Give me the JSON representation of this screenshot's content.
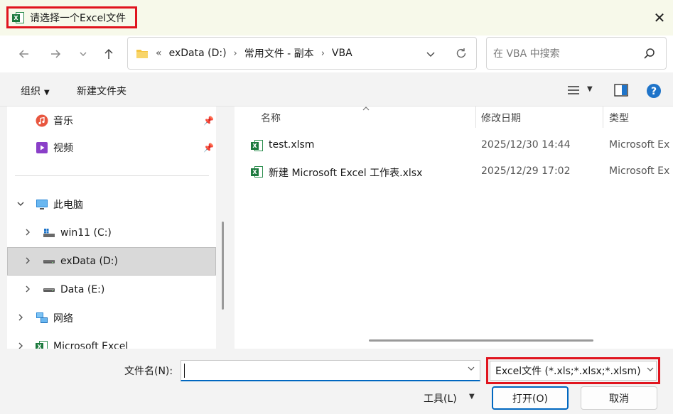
{
  "window": {
    "title": "请选择一个Excel文件"
  },
  "address": {
    "overflow": "«",
    "crumbs": [
      "exData (D:)",
      "常用文件 - 副本",
      "VBA"
    ]
  },
  "search": {
    "placeholder": "在 VBA 中搜索"
  },
  "toolbar": {
    "organize": "组织",
    "new_folder": "新建文件夹"
  },
  "sidebar": {
    "music": "音乐",
    "video": "视频",
    "this_pc": "此电脑",
    "win11": "win11 (C:)",
    "exdata": "exData (D:)",
    "data": "Data (E:)",
    "network": "网络",
    "excel": "Microsoft Excel"
  },
  "columns": {
    "name": "名称",
    "date": "修改日期",
    "type": "类型"
  },
  "files": [
    {
      "name": "test.xlsm",
      "date": "2025/12/30 14:44",
      "type": "Microsoft Ex"
    },
    {
      "name": "新建 Microsoft Excel 工作表.xlsx",
      "date": "2025/12/29 17:02",
      "type": "Microsoft Ex"
    }
  ],
  "bottom": {
    "filename_label": "文件名(N):",
    "filename_value": "",
    "filter": "Excel文件 (*.xls;*.xlsx;*.xlsm)",
    "tools": "工具(L)",
    "open": "打开(O)",
    "cancel": "取消"
  },
  "colors": {
    "accent": "#0067c0",
    "highlight": "#e0141e",
    "excel_green": "#1d7a3e"
  }
}
